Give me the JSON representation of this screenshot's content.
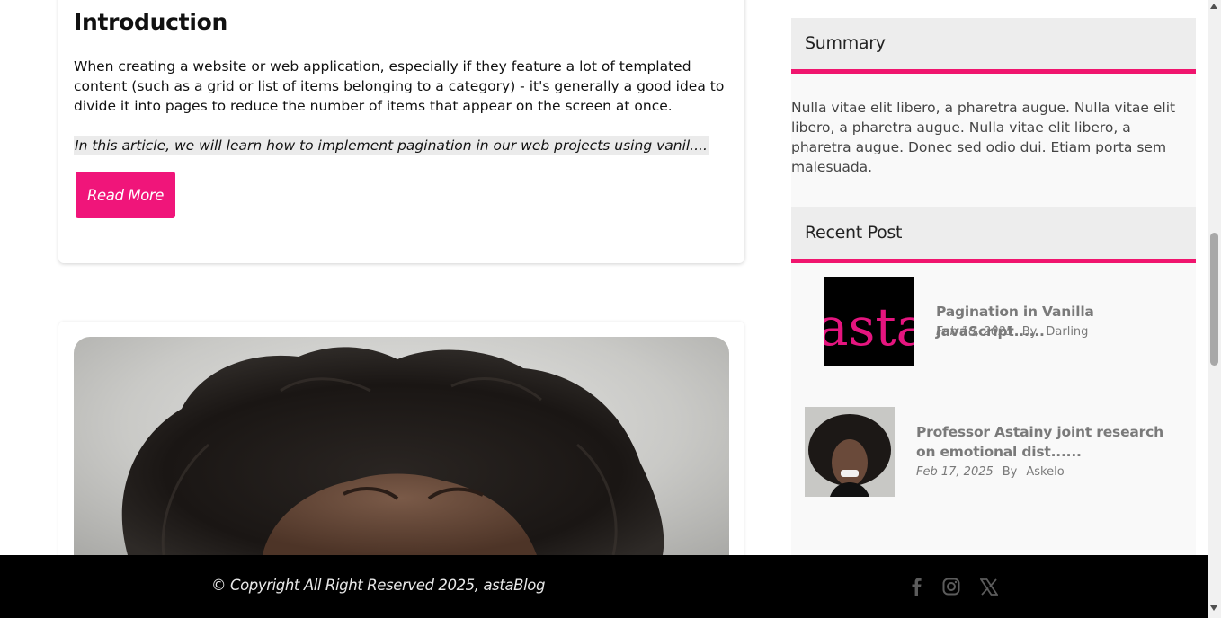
{
  "article": {
    "title": "Introduction",
    "body": "When creating a website or web application, especially if they feature a lot of templated content (such as a grid or list of items belonging to a category) - it's generally a good idea to divide it into pages to reduce the number of items that appear on the screen at once.",
    "excerpt": "In this article, we will learn how to implement pagination in our web projects using vanil....",
    "read_more_label": "Read More",
    "accent_color": "#f0157a"
  },
  "sidebar": {
    "summary": {
      "title": "Summary",
      "text": "Nulla vitae elit libero, a pharetra augue. Nulla vitae elit libero, a pharetra augue. Nulla vitae elit libero, a pharetra augue. Donec sed odio dui. Etiam porta sem malesuada."
    },
    "recent": {
      "title": "Recent Post",
      "posts": [
        {
          "title": "Pagination in Vanilla JavaScript......",
          "date": "Feb 18, 2025",
          "by_label": "By",
          "author": "Darling",
          "thumb_text": "asta"
        },
        {
          "title": "Professor Astainy joint research on emotional dist......",
          "date": "Feb 17, 2025",
          "by_label": "By",
          "author": "Askelo"
        }
      ]
    },
    "accent_color": "#f0156e"
  },
  "footer": {
    "copyright": "© Copyright All Right Reserved 2025, astaBlog",
    "social_icons": [
      "facebook-icon",
      "instagram-icon",
      "x-icon"
    ]
  }
}
